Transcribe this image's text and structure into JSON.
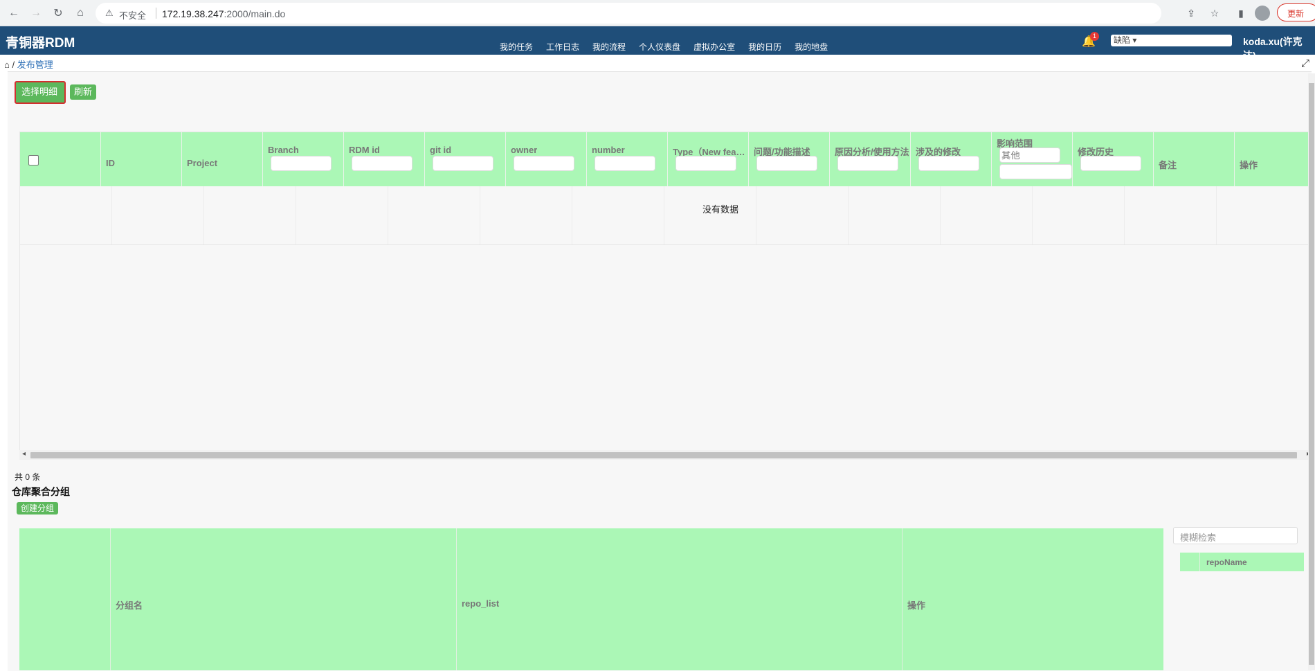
{
  "browser": {
    "insecure_label": "不安全",
    "url_host": "172.19.38.247",
    "url_path": ":2000/main.do",
    "update_label": "更新"
  },
  "app": {
    "brand": "青铜器RDM",
    "menu": [
      "我的任务",
      "工作日志",
      "我的流程",
      "个人仪表盘",
      "虚拟办公室",
      "我的日历",
      "我的地盘"
    ],
    "notification_count": "1",
    "select_value": "缺陷 ▾",
    "user": "koda.xu(许克达)"
  },
  "breadcrumb": {
    "separator": "/",
    "current": "发布管理"
  },
  "toolbar": {
    "select_detail": "选择明细",
    "refresh": "刷新"
  },
  "table": {
    "columns": [
      "ID",
      "Project",
      "Branch",
      "RDM id",
      "git id",
      "owner",
      "number",
      "Type（New feat...",
      "问题/功能描述",
      "原因分析/使用方法",
      "涉及的修改",
      "影响范围",
      "修改历史",
      "备注",
      "操作"
    ],
    "impact_placeholder": "其他",
    "empty_message": "没有数据",
    "total": "共 0 条"
  },
  "group_section": {
    "title": "仓库聚合分组",
    "create_button": "创建分组",
    "columns": [
      "分组名",
      "repo_list",
      "操作"
    ],
    "search_placeholder": "模糊检索",
    "repo_column": "repoName"
  }
}
